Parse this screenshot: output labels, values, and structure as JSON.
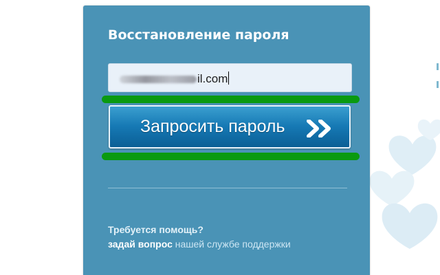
{
  "recovery_form": {
    "title": "Восстановление пароля",
    "email_field": {
      "value": "il.com",
      "obscured_prefix": true
    },
    "request_button": {
      "label": "Запросить пароль",
      "icon": "double-chevron-right-icon"
    },
    "help": {
      "title": "Требуется помощь?",
      "ask_text": "задай вопрос",
      "support_link_text": "нашей службе поддержки"
    }
  },
  "annotations": {
    "highlight_color": "#0a9a10"
  },
  "colors": {
    "panel": "#4a93b6",
    "button_top": "#3b9fd0",
    "button_bottom": "#0b5f96",
    "input_bg": "#e9f1f9"
  }
}
